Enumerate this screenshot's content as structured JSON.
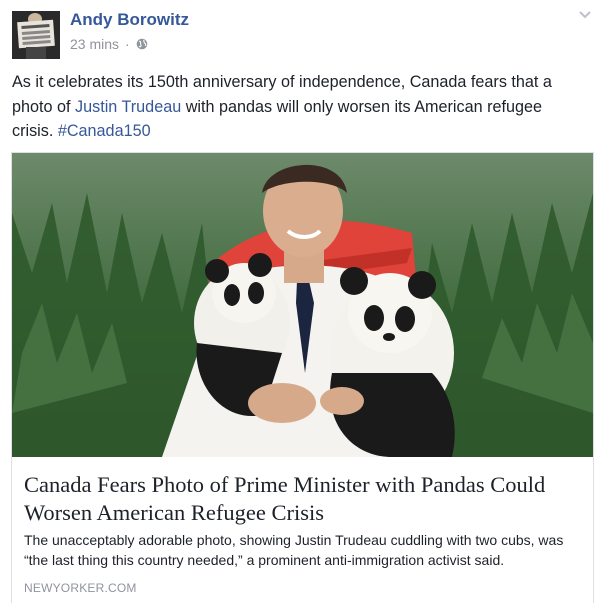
{
  "post": {
    "author": "Andy Borowitz",
    "time": "23 mins",
    "separator": "·",
    "privacy_icon": "globe-icon",
    "menu_icon": "chevron-down-icon",
    "caption": {
      "text_1": "As it celebrates its 150th anniversary of independence, Canada fears that a photo of ",
      "link_name": "Justin Trudeau",
      "text_2": " with pandas will only worsen its American refugee crisis. ",
      "hashtag": "#Canada150"
    }
  },
  "card": {
    "title": "Canada Fears Photo of Prime Minister with Pandas Could Worsen American Refugee Crisis",
    "description": "The unacceptably adorable photo, showing Justin Trudeau cuddling with two cubs, was “the last thing this country needed,” a prominent anti-immigration activist said.",
    "domain": "NEWYORKER.COM"
  },
  "colors": {
    "link": "#365899",
    "text": "#1d2129",
    "muted": "#90949c",
    "border": "#dddfe2"
  }
}
